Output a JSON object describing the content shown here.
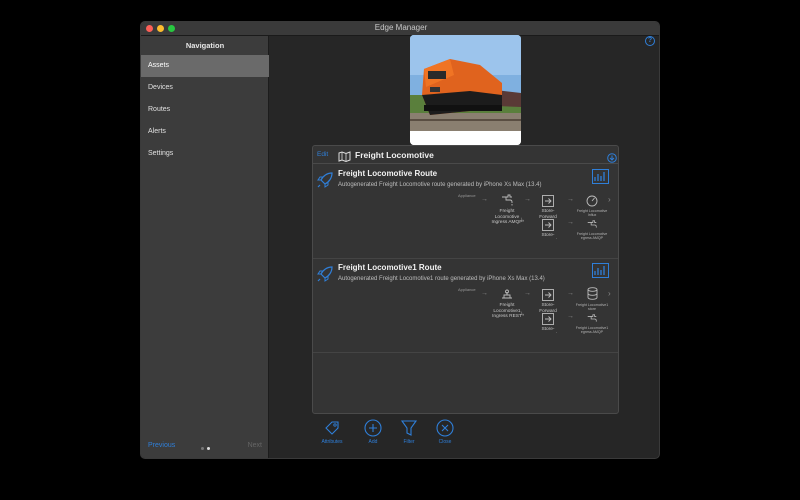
{
  "window": {
    "title": "Edge Manager"
  },
  "sidebar": {
    "title": "Navigation",
    "items": [
      {
        "label": "Assets",
        "active": true
      },
      {
        "label": "Devices"
      },
      {
        "label": "Routes"
      },
      {
        "label": "Alerts"
      },
      {
        "label": "Settings"
      }
    ],
    "previous": "Previous",
    "next": "Next"
  },
  "asset": {
    "image": "orange-locomotive-photo",
    "edit": "Edit",
    "title": "Freight Locomotive"
  },
  "routes": [
    {
      "title": "Freight Locomotive Route",
      "subtitle": "Autogenerated Freight Locomotive route generated by iPhone Xs Max (13.4)",
      "appliance": "Appliance",
      "ingress": "Freight Locomotive Ingress AMQP",
      "store1": "Store-Forward",
      "store2": "Store-Forward",
      "out1": "Freight Locomotive Influx",
      "out2": "Freight Locomotive egress AMQP"
    },
    {
      "title": "Freight Locomotive1 Route",
      "subtitle": "Autogenerated Freight Locomotive1 route generated by iPhone Xs Max (13.4)",
      "appliance": "Appliance",
      "ingress": "Freight Locomotive1 Ingress REST",
      "store1": "Store-Forward",
      "store2": "Store-Forward",
      "out1": "Freight Locomotive1 store",
      "out2": "Freight Locomotive1 egress AMQP"
    }
  ],
  "toolbar": {
    "attributes": "Attributes",
    "add": "Add",
    "filter": "Filter",
    "close": "Close"
  },
  "colors": {
    "accent": "#2f7fd9",
    "background": "#262626",
    "sidebar": "#3c3c3c"
  }
}
